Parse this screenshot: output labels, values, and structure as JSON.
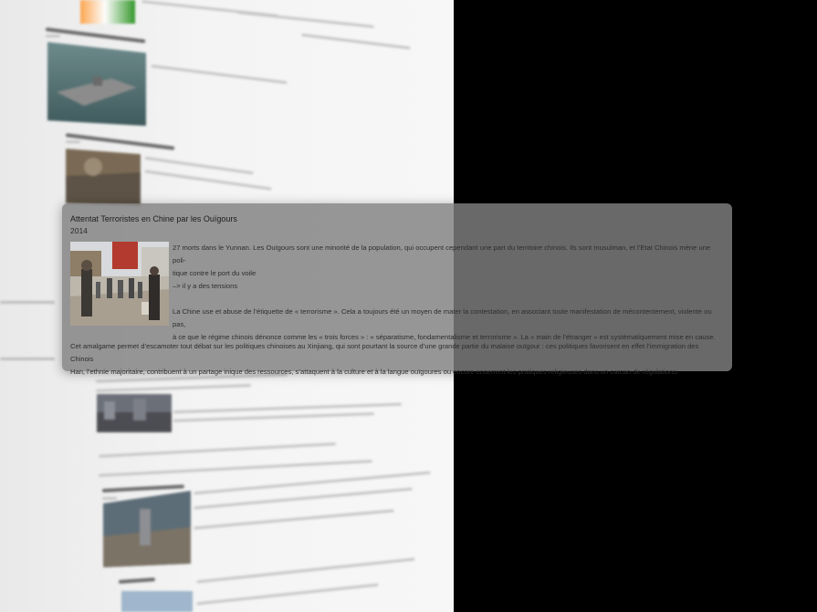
{
  "card": {
    "title": "Attentat Terroristes en Chine par les Ouïgours",
    "year": "2014",
    "paragraph1_a": "27 morts dans le Yunnan. Les Ouïgours sont une minorité de la population, qui occupent cependant une part du territoire chinois. Ils sont musulman, et l’Etat Chinois mène une poli-",
    "paragraph1_b": "tique contre le port du voile",
    "paragraph1_c": "–> il y a des tensions",
    "paragraph2_a": "La Chine use et abuse de l’étiquette de « terrorisme ». Cela a toujours été un moyen de mater la contestation, en associant toute manifestation de mécontentement, violente ou pas,",
    "paragraph2_b": "à ce que le régime chinois dénonce comme les « trois forces » : « séparatisme, fondamentalisme et terrorisme ». La « main de l’étranger » est systématiquement mise en cause.",
    "paragraph3_a": "Cet amalgame permet d’escamoter tout débat sur les politiques chinoises au Xinjiang, qui sont pourtant la source d’une grande partie du malaise ouïgour : ces politiques favorisent en effet l’immigration des Chinois",
    "paragraph3_b": "Han, l’ethnie majoritaire, contribuent à un partage inique des ressources, s’attaquent à la culture et à la langue ouïgoures ou encore enserrent les pratiques religieuses dans un carcan de régulations."
  },
  "background": {
    "icons": [
      "aircraft-carrier-photo",
      "flood-photo",
      "crowd-photo",
      "city-aerial-photo"
    ]
  }
}
